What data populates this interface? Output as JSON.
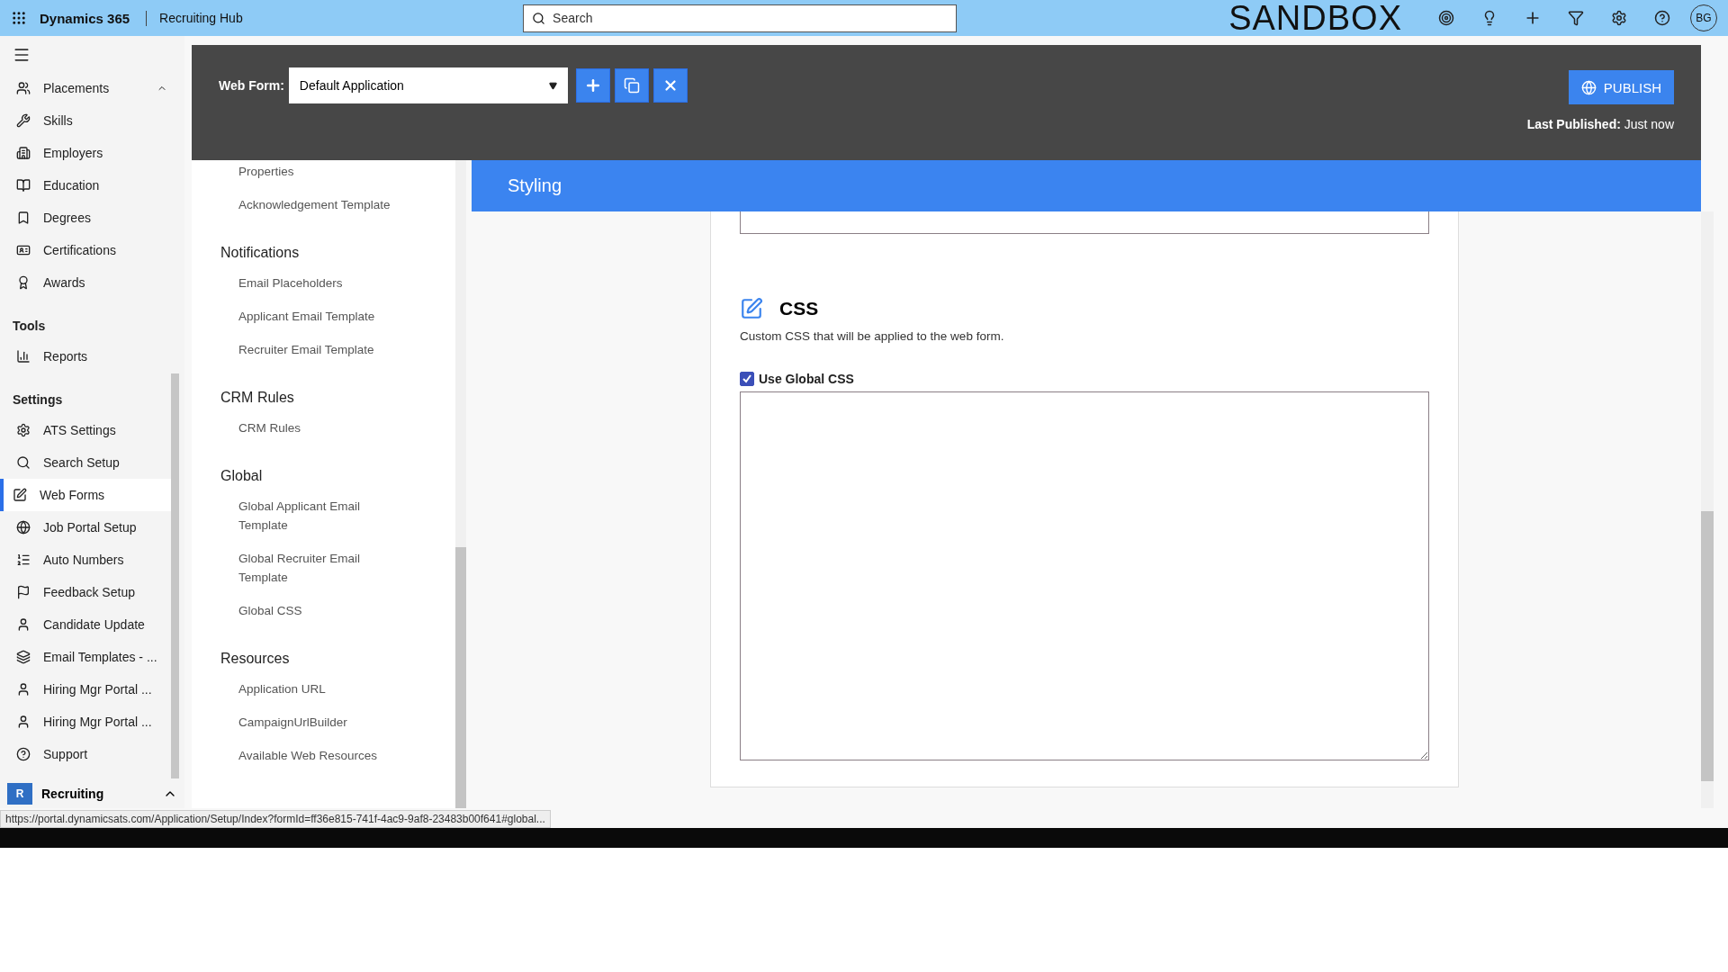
{
  "topbar": {
    "app_name": "Dynamics 365",
    "area_name": "Recruiting Hub",
    "search": {
      "placeholder": "Search"
    },
    "environment": "SANDBOX",
    "avatar": "BG"
  },
  "sidebar": {
    "groups": [
      {
        "items": [
          {
            "label": "Placements",
            "selected": false
          },
          {
            "label": "Skills",
            "selected": false
          },
          {
            "label": "Employers",
            "selected": false
          },
          {
            "label": "Education",
            "selected": false
          },
          {
            "label": "Degrees",
            "selected": false
          },
          {
            "label": "Certifications",
            "selected": false
          },
          {
            "label": "Awards",
            "selected": false
          }
        ]
      },
      {
        "title": "Tools",
        "items": [
          {
            "label": "Reports",
            "selected": false
          }
        ]
      },
      {
        "title": "Settings",
        "items": [
          {
            "label": "ATS Settings",
            "selected": false
          },
          {
            "label": "Search Setup",
            "selected": false
          },
          {
            "label": "Web Forms",
            "selected": true
          },
          {
            "label": "Job Portal Setup",
            "selected": false
          },
          {
            "label": "Auto Numbers",
            "selected": false
          },
          {
            "label": "Feedback Setup",
            "selected": false
          },
          {
            "label": "Candidate Update",
            "selected": false
          },
          {
            "label": "Email Templates - ...",
            "selected": false
          },
          {
            "label": "Hiring Mgr Portal ...",
            "selected": false
          },
          {
            "label": "Hiring Mgr Portal ...",
            "selected": false
          },
          {
            "label": "Support",
            "selected": false
          }
        ]
      }
    ],
    "area": {
      "badge": "R",
      "label": "Recruiting"
    }
  },
  "web_form": {
    "label": "Web Form:",
    "value": "Default Application",
    "publish": "PUBLISH",
    "last_published_label": "Last Published:",
    "last_published_value": "Just now"
  },
  "nav": [
    {
      "items": [
        "Properties",
        "Acknowledgement Template"
      ]
    },
    {
      "title": "Notifications",
      "items": [
        "Email Placeholders",
        "Applicant Email Template",
        "Recruiter Email Template"
      ]
    },
    {
      "title": "CRM Rules",
      "items": [
        "CRM Rules"
      ]
    },
    {
      "title": "Global",
      "items": [
        "Global Applicant Email Template",
        "Global Recruiter Email Template",
        "Global CSS"
      ]
    },
    {
      "title": "Resources",
      "items": [
        "Application URL",
        "CampaignUrlBuilder",
        "Available Web Resources"
      ]
    }
  ],
  "panel": {
    "title": "Styling",
    "section": {
      "title": "CSS",
      "description": "Custom CSS that will be applied to the web form.",
      "checkbox": {
        "label": "Use Global CSS",
        "checked": true
      }
    }
  },
  "status_url": "https://portal.dynamicsats.com/Application/Setup/Index?formId=ff36e815-741f-4ac9-9af8-23483b00f641#global..."
}
